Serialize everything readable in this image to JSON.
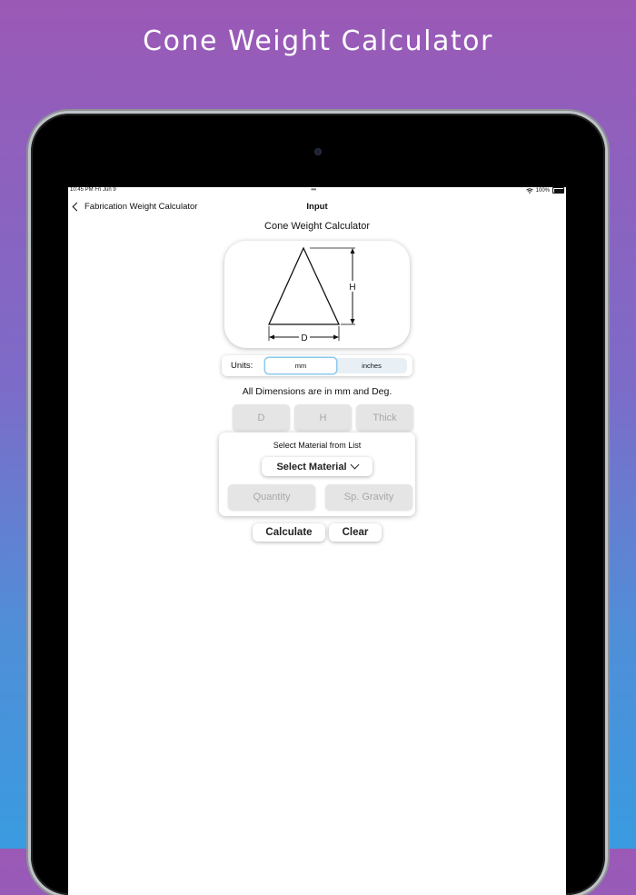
{
  "banner": {
    "title": "Cone Weight Calculator"
  },
  "status_bar": {
    "time": "10:45 PM  Fri Jun 9",
    "battery": "100%"
  },
  "nav": {
    "back_label": "Fabrication Weight Calculator",
    "title": "Input"
  },
  "page": {
    "heading": "Cone Weight Calculator",
    "dims_note": "All Dimensions are in mm and Deg."
  },
  "diagram": {
    "height_label": "H",
    "diameter_label": "D"
  },
  "units": {
    "label": "Units:",
    "options": [
      "mm",
      "inches"
    ],
    "selected": "mm"
  },
  "dimensions": {
    "d_placeholder": "D",
    "h_placeholder": "H",
    "thick_placeholder": "Thick"
  },
  "material": {
    "title": "Select Material from List",
    "select_label": "Select Material",
    "quantity_placeholder": "Quantity",
    "gravity_placeholder": "Sp. Gravity"
  },
  "actions": {
    "calculate_label": "Calculate",
    "clear_label": "Clear"
  },
  "colors": {
    "accent": "#8cc8ee",
    "field_bg": "#e5e5e5",
    "gradient_top": "#9b59b6",
    "gradient_bottom": "#3a9be0"
  }
}
